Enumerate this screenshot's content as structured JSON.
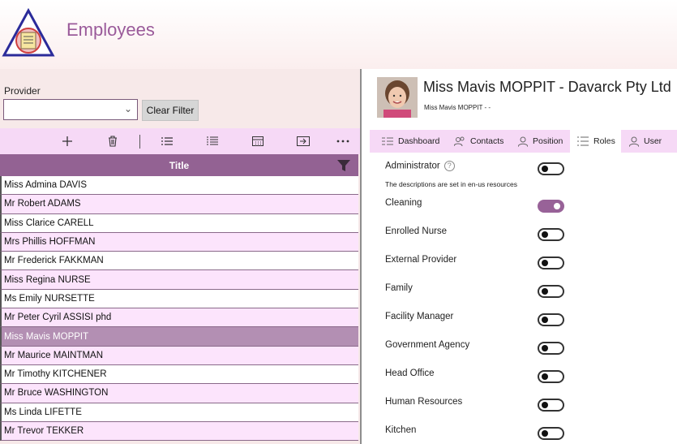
{
  "app": {
    "title": "Employees"
  },
  "filter": {
    "provider_label": "Provider",
    "provider_value": "",
    "clear_label": "Clear Filter"
  },
  "grid": {
    "column_title": "Title",
    "rows": [
      "Miss Admina DAVIS",
      "Mr Robert ADAMS",
      "Miss Clarice CARELL",
      "Mrs Phillis HOFFMAN",
      "Mr Frederick FAKKMAN",
      "Miss Regina NURSE",
      "Ms Emily NURSETTE",
      "Mr Peter Cyril ASSISI phd",
      "Miss Mavis MOPPIT",
      "Mr Maurice MAINTMAN",
      "Mr Timothy KITCHENER",
      "Mr Bruce WASHINGTON",
      "Ms Linda LIFETTE",
      "Mr Trevor TEKKER"
    ],
    "selected_index": 8
  },
  "detail": {
    "name": "Miss Mavis MOPPIT  - Davarck Pty Ltd",
    "subtitle": "Miss Mavis MOPPIT -   -",
    "tabs": [
      {
        "label": "Dashboard"
      },
      {
        "label": "Contacts"
      },
      {
        "label": "Position"
      },
      {
        "label": "Roles"
      },
      {
        "label": "User"
      }
    ],
    "active_tab": "Roles",
    "note": "The descriptions are set in en-us resources",
    "roles": [
      {
        "label": "Administrator",
        "on": false
      },
      {
        "label": "Cleaning",
        "on": true
      },
      {
        "label": "Enrolled Nurse",
        "on": false
      },
      {
        "label": "External Provider",
        "on": false
      },
      {
        "label": "Family",
        "on": false
      },
      {
        "label": "Facility Manager",
        "on": false
      },
      {
        "label": "Government Agency",
        "on": false
      },
      {
        "label": "Head Office",
        "on": false
      },
      {
        "label": "Human Resources",
        "on": false
      },
      {
        "label": "Kitchen",
        "on": false
      }
    ]
  },
  "colors": {
    "accent": "#936293",
    "row_alt": "#fce4fc",
    "selected": "#b38fb3",
    "toggle_on": "#986298"
  }
}
